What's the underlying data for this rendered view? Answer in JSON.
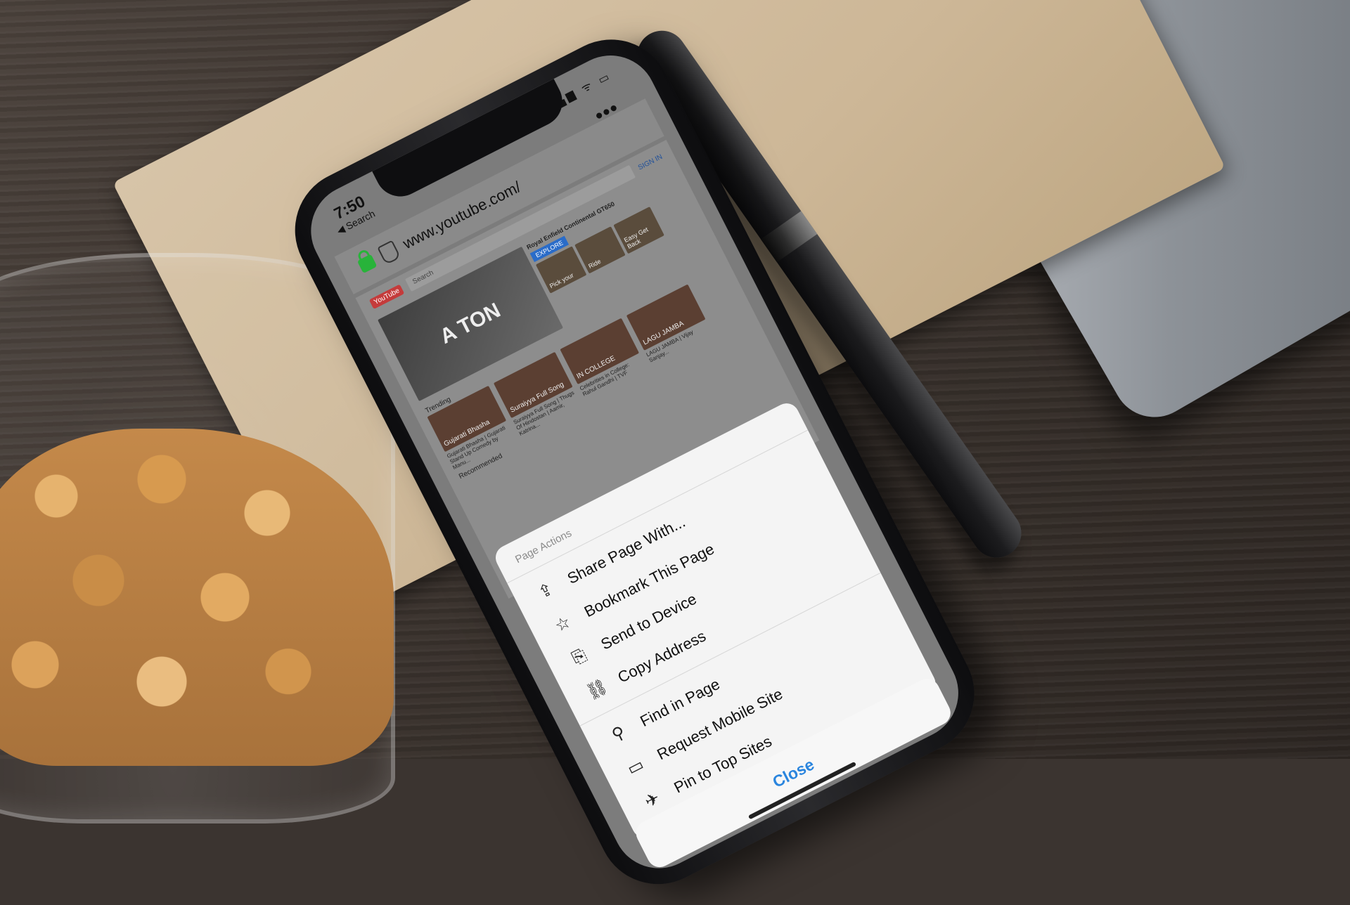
{
  "status_bar": {
    "time": "7:50",
    "back_label": "◀ Search",
    "icons": "▂▄▆ ᯤ ▭"
  },
  "browser": {
    "url": "www.youtube.com/",
    "more_label": "•••"
  },
  "youtube": {
    "logo": "YouTube",
    "search_placeholder": "Search",
    "sign_in": "SIGN IN",
    "hero_text": "A TON",
    "ad_title": "Royal Enfield Continental GT650",
    "ad_button": "EXPLORE",
    "ad_thumbs": [
      "Pick your",
      "Ride",
      "Easy Get Back"
    ],
    "trending_label": "Trending",
    "recommended_label": "Recommended",
    "videos": [
      {
        "thumb": "Gujarati Bhasha",
        "title": "Gujarati Bhasha | Gujarati Stand Up Comedy by Manu..."
      },
      {
        "thumb": "Suraiyya Full Song",
        "title": "Suraiyya Full Song | Thugs Of Hindostan | Aamir, Katrina..."
      },
      {
        "thumb": "IN COLLEGE",
        "title": "Celebrities in College: Rahul Gandhi | TVF"
      },
      {
        "thumb": "LAGU JAMBA",
        "title": "LAGU JAMBA | Vijay Sanjay..."
      }
    ]
  },
  "action_sheet": {
    "header": "Page Actions",
    "groups": [
      [
        {
          "icon": "share-icon",
          "glyph": "⇪",
          "label": "Share Page With..."
        },
        {
          "icon": "star-icon",
          "glyph": "☆",
          "label": "Bookmark This Page"
        },
        {
          "icon": "send-to-device-icon",
          "glyph": "⎘",
          "label": "Send to Device"
        },
        {
          "icon": "link-icon",
          "glyph": "⛓",
          "label": "Copy Address"
        }
      ],
      [
        {
          "icon": "search-icon",
          "glyph": "⚲",
          "label": "Find in Page"
        },
        {
          "icon": "laptop-icon",
          "glyph": "▭",
          "label": "Request Mobile Site"
        },
        {
          "icon": "pin-icon",
          "glyph": "✈",
          "label": "Pin to Top Sites"
        }
      ]
    ],
    "close_label": "Close"
  },
  "colors": {
    "accent": "#2a85de",
    "lock": "#28b33a",
    "sheet_bg": "#f4f4f4"
  }
}
